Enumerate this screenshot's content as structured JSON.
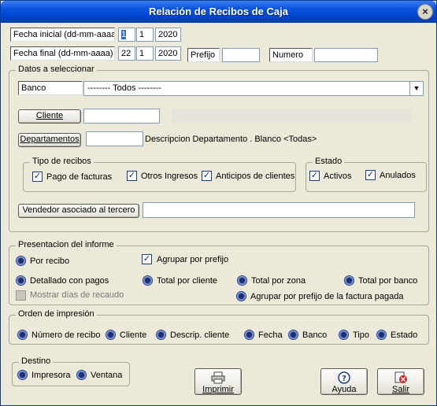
{
  "window": {
    "title": "Relación de Recibos de Caja",
    "close": "×"
  },
  "fecha_inicial": {
    "label": "Fecha inicial (dd-mm-aaaa)",
    "dd": "1",
    "mm": "1",
    "aaaa": "2020"
  },
  "fecha_final": {
    "label": "Fecha final (dd-mm-aaaa)",
    "dd": "22",
    "mm": "1",
    "aaaa": "2020"
  },
  "prefijo": {
    "label": "Prefijo",
    "value": ""
  },
  "numero": {
    "label": "Numero",
    "value": ""
  },
  "datos": {
    "title": "Datos a seleccionar",
    "banco_label": "Banco",
    "banco_value": "-------- Todos --------",
    "cliente_button": "Cliente",
    "cliente_value": "",
    "departamentos_button": "Departamentos",
    "departamentos_value": "",
    "departamento_desc": "Descripcion Departamento . Blanco <Todas>",
    "tipo_recibos_title": "Tipo de recibos",
    "pago_facturas": "Pago de facturas",
    "otros_ingresos": "Otros Ingresos",
    "anticipos": "Anticipos de clientes",
    "estado_title": "Estado",
    "activos": "Activos",
    "anulados": "Anulados",
    "vendedor_button": "Vendedor  asociado al tercero",
    "vendedor_value": ""
  },
  "presentacion": {
    "title": "Presentacion del informe",
    "por_recibo": "Por recibo",
    "agrupar_prefijo": "Agrupar por prefijo",
    "detallado": "Detallado con pagos",
    "total_cliente": "Total por cliente",
    "total_zona": "Total por zona",
    "total_banco": "Total por banco",
    "mostrar_dias": "Mostrar días de recaudo",
    "agrupar_prefijo_factura": "Agrupar por prefijo de la factura pagada"
  },
  "orden": {
    "title": "Orden de impresión",
    "numero_recibo": "Número de recibo",
    "cliente": "Cliente",
    "descrip_cliente": "Descrip. cliente",
    "fecha": "Fecha",
    "banco": "Banco",
    "tipo": "Tipo",
    "estado": "Estado"
  },
  "destino": {
    "title": "Destino",
    "impresora": "Impresora",
    "ventana": "Ventana"
  },
  "buttons": {
    "imprimir": "Imprimir",
    "ayuda": "Ayuda",
    "salir": "Salir"
  }
}
